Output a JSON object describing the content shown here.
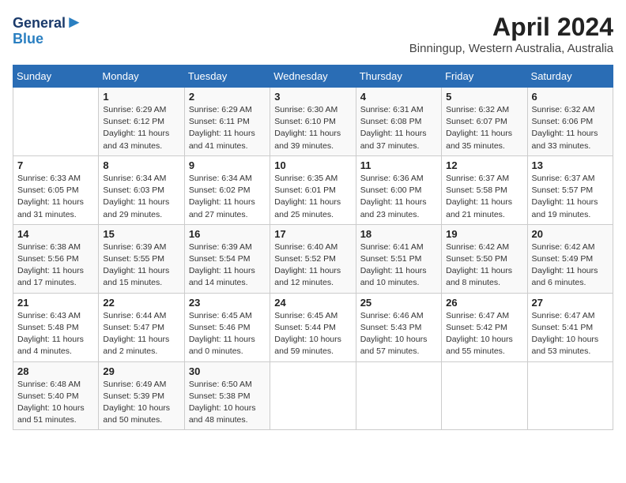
{
  "header": {
    "logo_line1": "General",
    "logo_line2": "Blue",
    "title": "April 2024",
    "subtitle": "Binningup, Western Australia, Australia"
  },
  "calendar": {
    "days_of_week": [
      "Sunday",
      "Monday",
      "Tuesday",
      "Wednesday",
      "Thursday",
      "Friday",
      "Saturday"
    ],
    "rows": [
      [
        {
          "num": "",
          "detail": ""
        },
        {
          "num": "1",
          "detail": "Sunrise: 6:29 AM\nSunset: 6:12 PM\nDaylight: 11 hours\nand 43 minutes."
        },
        {
          "num": "2",
          "detail": "Sunrise: 6:29 AM\nSunset: 6:11 PM\nDaylight: 11 hours\nand 41 minutes."
        },
        {
          "num": "3",
          "detail": "Sunrise: 6:30 AM\nSunset: 6:10 PM\nDaylight: 11 hours\nand 39 minutes."
        },
        {
          "num": "4",
          "detail": "Sunrise: 6:31 AM\nSunset: 6:08 PM\nDaylight: 11 hours\nand 37 minutes."
        },
        {
          "num": "5",
          "detail": "Sunrise: 6:32 AM\nSunset: 6:07 PM\nDaylight: 11 hours\nand 35 minutes."
        },
        {
          "num": "6",
          "detail": "Sunrise: 6:32 AM\nSunset: 6:06 PM\nDaylight: 11 hours\nand 33 minutes."
        }
      ],
      [
        {
          "num": "7",
          "detail": "Sunrise: 6:33 AM\nSunset: 6:05 PM\nDaylight: 11 hours\nand 31 minutes."
        },
        {
          "num": "8",
          "detail": "Sunrise: 6:34 AM\nSunset: 6:03 PM\nDaylight: 11 hours\nand 29 minutes."
        },
        {
          "num": "9",
          "detail": "Sunrise: 6:34 AM\nSunset: 6:02 PM\nDaylight: 11 hours\nand 27 minutes."
        },
        {
          "num": "10",
          "detail": "Sunrise: 6:35 AM\nSunset: 6:01 PM\nDaylight: 11 hours\nand 25 minutes."
        },
        {
          "num": "11",
          "detail": "Sunrise: 6:36 AM\nSunset: 6:00 PM\nDaylight: 11 hours\nand 23 minutes."
        },
        {
          "num": "12",
          "detail": "Sunrise: 6:37 AM\nSunset: 5:58 PM\nDaylight: 11 hours\nand 21 minutes."
        },
        {
          "num": "13",
          "detail": "Sunrise: 6:37 AM\nSunset: 5:57 PM\nDaylight: 11 hours\nand 19 minutes."
        }
      ],
      [
        {
          "num": "14",
          "detail": "Sunrise: 6:38 AM\nSunset: 5:56 PM\nDaylight: 11 hours\nand 17 minutes."
        },
        {
          "num": "15",
          "detail": "Sunrise: 6:39 AM\nSunset: 5:55 PM\nDaylight: 11 hours\nand 15 minutes."
        },
        {
          "num": "16",
          "detail": "Sunrise: 6:39 AM\nSunset: 5:54 PM\nDaylight: 11 hours\nand 14 minutes."
        },
        {
          "num": "17",
          "detail": "Sunrise: 6:40 AM\nSunset: 5:52 PM\nDaylight: 11 hours\nand 12 minutes."
        },
        {
          "num": "18",
          "detail": "Sunrise: 6:41 AM\nSunset: 5:51 PM\nDaylight: 11 hours\nand 10 minutes."
        },
        {
          "num": "19",
          "detail": "Sunrise: 6:42 AM\nSunset: 5:50 PM\nDaylight: 11 hours\nand 8 minutes."
        },
        {
          "num": "20",
          "detail": "Sunrise: 6:42 AM\nSunset: 5:49 PM\nDaylight: 11 hours\nand 6 minutes."
        }
      ],
      [
        {
          "num": "21",
          "detail": "Sunrise: 6:43 AM\nSunset: 5:48 PM\nDaylight: 11 hours\nand 4 minutes."
        },
        {
          "num": "22",
          "detail": "Sunrise: 6:44 AM\nSunset: 5:47 PM\nDaylight: 11 hours\nand 2 minutes."
        },
        {
          "num": "23",
          "detail": "Sunrise: 6:45 AM\nSunset: 5:46 PM\nDaylight: 11 hours\nand 0 minutes."
        },
        {
          "num": "24",
          "detail": "Sunrise: 6:45 AM\nSunset: 5:44 PM\nDaylight: 10 hours\nand 59 minutes."
        },
        {
          "num": "25",
          "detail": "Sunrise: 6:46 AM\nSunset: 5:43 PM\nDaylight: 10 hours\nand 57 minutes."
        },
        {
          "num": "26",
          "detail": "Sunrise: 6:47 AM\nSunset: 5:42 PM\nDaylight: 10 hours\nand 55 minutes."
        },
        {
          "num": "27",
          "detail": "Sunrise: 6:47 AM\nSunset: 5:41 PM\nDaylight: 10 hours\nand 53 minutes."
        }
      ],
      [
        {
          "num": "28",
          "detail": "Sunrise: 6:48 AM\nSunset: 5:40 PM\nDaylight: 10 hours\nand 51 minutes."
        },
        {
          "num": "29",
          "detail": "Sunrise: 6:49 AM\nSunset: 5:39 PM\nDaylight: 10 hours\nand 50 minutes."
        },
        {
          "num": "30",
          "detail": "Sunrise: 6:50 AM\nSunset: 5:38 PM\nDaylight: 10 hours\nand 48 minutes."
        },
        {
          "num": "",
          "detail": ""
        },
        {
          "num": "",
          "detail": ""
        },
        {
          "num": "",
          "detail": ""
        },
        {
          "num": "",
          "detail": ""
        }
      ]
    ]
  }
}
